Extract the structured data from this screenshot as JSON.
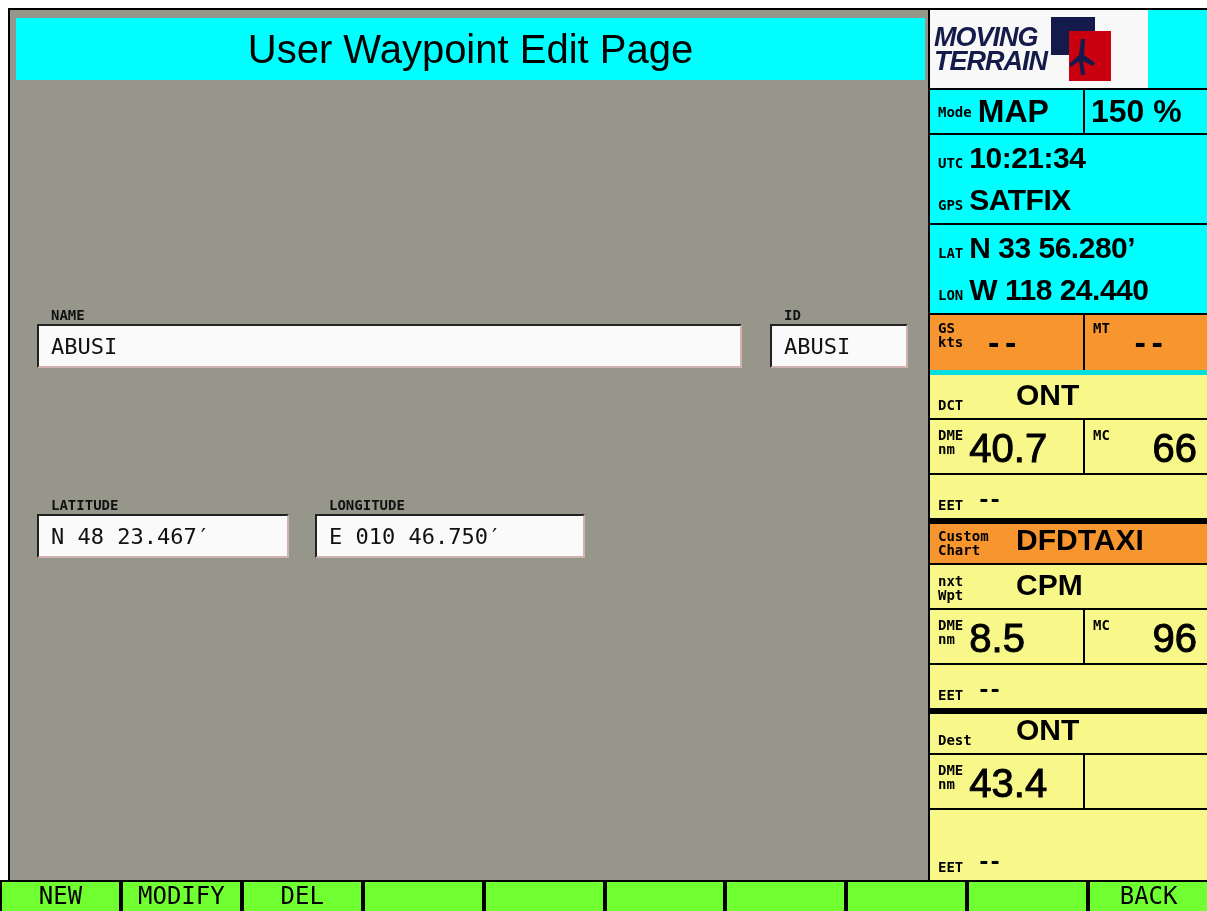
{
  "title": "User Waypoint Edit Page",
  "fields": [
    {
      "label": "NAME",
      "value": "ABUSI",
      "kind": "wide"
    },
    {
      "label": "ID",
      "value": "ABUSI",
      "kind": "short"
    },
    {
      "label": "LATITUDE",
      "value": "N 48 23.467′",
      "kind": "coord"
    },
    {
      "label": "LONGITUDE",
      "value": "E 010 46.750′",
      "kind": "coord"
    }
  ],
  "logo": [
    "MOVING",
    "TERRAIN"
  ],
  "rows": [
    {
      "kind": "split",
      "color": "#00ffff",
      "cells": [
        {
          "label": [
            "Mode"
          ],
          "value": "MAP"
        },
        {
          "value": "150 %"
        }
      ]
    },
    {
      "kind": "stack",
      "color": "#00ffff",
      "cells": [
        {
          "label": [
            "UTC"
          ],
          "value": "10:21:34"
        },
        {
          "label": [
            "GPS"
          ],
          "value": "SATFIX"
        }
      ]
    },
    {
      "kind": "stack",
      "color": "#00ffff",
      "cells": [
        {
          "label": [
            "LAT"
          ],
          "value": "N 33 56.280’"
        },
        {
          "label": [
            "LON"
          ],
          "value": "W 118 24.440"
        }
      ]
    },
    {
      "kind": "speed",
      "color": "#f7962f",
      "cells": [
        {
          "label": [
            "GS",
            "kts"
          ],
          "value": "--"
        },
        {
          "label": [
            "MT"
          ],
          "value": "--"
        }
      ]
    },
    {
      "kind": "title",
      "color": "#f8f88a",
      "cells": [
        {
          "label": [
            "DCT"
          ],
          "value": "ONT"
        }
      ]
    },
    {
      "kind": "big",
      "color": "#f8f88a",
      "cells": [
        {
          "label": [
            "DME",
            "nm"
          ],
          "value": "40.7"
        },
        {
          "label": [
            "MC"
          ],
          "value": "66"
        }
      ]
    },
    {
      "kind": "note",
      "color": "#f8f88a",
      "cells": [
        {
          "label": [
            "EET"
          ],
          "value": "--"
        }
      ]
    },
    {
      "kind": "title",
      "color": "#f7962f",
      "cells": [
        {
          "label": [
            "Custom",
            "Chart"
          ],
          "value": "DFDTAXI"
        }
      ]
    },
    {
      "kind": "title",
      "color": "#f8f88a",
      "cells": [
        {
          "label": [
            "nxt",
            "Wpt"
          ],
          "value": "CPM"
        }
      ]
    },
    {
      "kind": "big",
      "color": "#f8f88a",
      "cells": [
        {
          "label": [
            "DME",
            "nm"
          ],
          "value": "8.5"
        },
        {
          "label": [
            "MC"
          ],
          "value": "96"
        }
      ]
    },
    {
      "kind": "note",
      "color": "#f8f88a",
      "cells": [
        {
          "label": [
            "EET"
          ],
          "value": "--"
        }
      ]
    },
    {
      "kind": "title",
      "color": "#f8f88a",
      "cells": [
        {
          "label": [
            "Dest"
          ],
          "value": "ONT"
        }
      ]
    },
    {
      "kind": "big",
      "color": "#f8f88a",
      "cells": [
        {
          "label": [
            "DME",
            "nm"
          ],
          "value": "43.4"
        },
        {}
      ]
    },
    {
      "kind": "note",
      "color": "#f8f88a",
      "cells": [
        {
          "label": [
            "EET"
          ],
          "value": "--"
        }
      ]
    }
  ],
  "softkeys": [
    {
      "kind": "label",
      "label": "NEW"
    },
    {
      "kind": "label",
      "label": "MODIFY"
    },
    {
      "kind": "label",
      "label": "DEL"
    },
    {
      "kind": "blank"
    },
    {
      "kind": "blank"
    },
    {
      "kind": "blank"
    },
    {
      "kind": "blank"
    },
    {
      "kind": "blank"
    },
    {
      "kind": "blank"
    },
    {
      "kind": "label",
      "label": "BACK"
    }
  ]
}
